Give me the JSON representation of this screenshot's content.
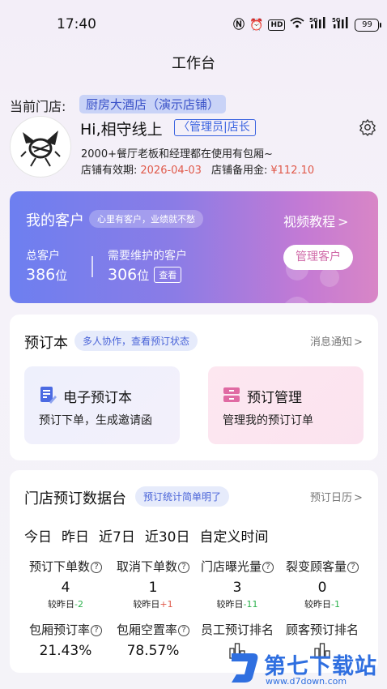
{
  "status_bar": {
    "time": "17:40",
    "battery": "99",
    "hd": "HD",
    "sig": "5G"
  },
  "header": {
    "title": "工作台"
  },
  "store": {
    "label": "当前门店:",
    "name": "厨房大酒店（演示店铺）"
  },
  "profile": {
    "greeting": "Hi,相守线上",
    "role": "管理员|店长",
    "description": "2000+餐厅老板和经理都在使用有包厢~",
    "expiry_label": "店铺有效期:",
    "expiry_date": "2026-04-03",
    "fund_label": "店铺备用金:",
    "fund_value": "¥112.10"
  },
  "customers": {
    "title": "我的客户",
    "tag": "心里有客户，业绩就不愁",
    "video_link": "视频教程",
    "total_label": "总客户",
    "total_value": "386",
    "unit": "位",
    "maintain_label": "需要维护的客户",
    "maintain_value": "306",
    "view_button": "查看",
    "manage_button": "管理客户"
  },
  "booking": {
    "title": "预订本",
    "tag": "多人协作，查看预订状态",
    "link": "消息通知",
    "tiles": [
      {
        "title": "电子预订本",
        "subtitle": "预订下单，生成邀请函"
      },
      {
        "title": "预订管理",
        "subtitle": "管理我的预订订单"
      }
    ]
  },
  "stats": {
    "title": "门店预订数据台",
    "tag": "预订统计简单明了",
    "link": "预订日历",
    "tabs": [
      "今日",
      "昨日",
      "近7日",
      "近30日",
      "自定义时间"
    ],
    "cmp_label": "较昨日",
    "metrics": [
      {
        "label": "预订下单数",
        "value": "4",
        "delta": "-2"
      },
      {
        "label": "取消下单数",
        "value": "1",
        "delta": "+1"
      },
      {
        "label": "门店曝光量",
        "value": "3",
        "delta": "-11"
      },
      {
        "label": "裂变顾客量",
        "value": "0",
        "delta": "-1"
      }
    ],
    "metrics2": [
      {
        "label": "包厢预订率",
        "value": "21.43%"
      },
      {
        "label": "包厢空置率",
        "value": "78.57%"
      },
      {
        "label": "员工预订排名",
        "value": ""
      },
      {
        "label": "顾客预订排名",
        "value": ""
      }
    ]
  },
  "watermark": {
    "text": "第七下载站",
    "url": "www.d7down.com"
  },
  "colors": {
    "accent": "#3a63e0",
    "red": "#e0594a",
    "green": "#2bb24c",
    "pink": "#d06aa8"
  }
}
